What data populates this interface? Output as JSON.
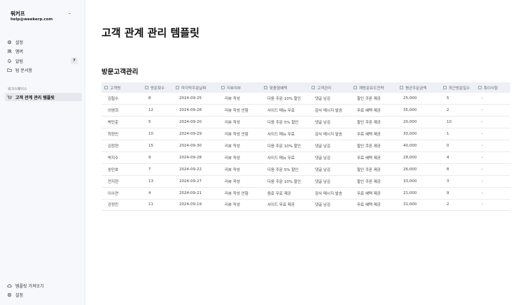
{
  "workspace": {
    "name": "워커프",
    "email": "help@weekerp.com",
    "more": "···"
  },
  "sidebar": {
    "items": [
      {
        "label": "설정",
        "icon": "gear-icon"
      },
      {
        "label": "멤버",
        "icon": "users-icon"
      },
      {
        "label": "알림",
        "icon": "bell-icon",
        "badge": "7"
      },
      {
        "label": "팀 문서함",
        "icon": "folder-icon"
      }
    ],
    "section_label": "워크스페이스",
    "workspace_items": [
      {
        "label": "고객 관계 관리 템플릿",
        "icon": "cart-icon"
      }
    ],
    "bottom_items": [
      {
        "label": "템플릿 가져오기",
        "icon": "cloud-icon"
      },
      {
        "label": "설정",
        "icon": "gear-icon"
      }
    ]
  },
  "main": {
    "title": "고객 관계 관리 템플릿",
    "table_title": "방문고객관리"
  },
  "table": {
    "columns": [
      "고객명",
      "방문횟수",
      "마지막주문날짜",
      "리뷰여부",
      "맞춤형혜택",
      "고객관리",
      "재방문유도전략",
      "평균주문금액",
      "최근방문일수",
      "특이사항"
    ],
    "rows": [
      [
        "김철수",
        "8",
        "2024-09-25",
        "리뷰 작성",
        "다음 주문 10% 할인",
        "댓글 남김",
        "할인 쿠폰 제공",
        "25,000",
        "5",
        "-"
      ],
      [
        "이영희",
        "12",
        "2024-09-28",
        "리뷰 작성 안함",
        "사이드 메뉴 무료",
        "감사 메시지 발송",
        "무료 혜택 제공",
        "35,000",
        "2",
        "-"
      ],
      [
        "박민준",
        "5",
        "2024-09-20",
        "리뷰 작성",
        "다음 주문 5% 할인",
        "댓글 남김",
        "할인 쿠폰 제공",
        "20,000",
        "10",
        "-"
      ],
      [
        "최정민",
        "10",
        "2024-09-29",
        "리뷰 작성 안함",
        "사이드 메뉴 무료",
        "감사 메시지 발송",
        "무료 혜택 제공",
        "30,000",
        "1",
        "-"
      ],
      [
        "김정현",
        "15",
        "2024-09-30",
        "리뷰 작성",
        "다음 주문 10% 할인",
        "댓글 남김",
        "할인 쿠폰 제공",
        "40,000",
        "0",
        "-"
      ],
      [
        "박지수",
        "9",
        "2024-09-28",
        "리뷰 작성",
        "사이드 메뉴 무료",
        "댓글 남김",
        "무료 혜택 제공",
        "28,000",
        "4",
        "-"
      ],
      [
        "송민호",
        "7",
        "2024-09-22",
        "리뷰 작성",
        "다음 주문 5% 할인",
        "댓글 남김",
        "할인 쿠폰 제공",
        "26,000",
        "8",
        "-"
      ],
      [
        "전지현",
        "13",
        "2024-09-27",
        "리뷰 작성",
        "다음 주문 10% 할인",
        "댓글 남김",
        "할인 쿠폰 제공",
        "33,000",
        "3",
        "-"
      ],
      [
        "이수연",
        "4",
        "2024-09-21",
        "리뷰 작성 안함",
        "음료 무료 제공",
        "감사 메시지 발송",
        "무료 혜택 제공",
        "21,000",
        "9",
        "-"
      ],
      [
        "강정민",
        "11",
        "2024-09-19",
        "리뷰 작성",
        "사이드 무료 제공",
        "댓글 남김",
        "무료 혜택 제공",
        "31,000",
        "2",
        "-"
      ]
    ]
  }
}
